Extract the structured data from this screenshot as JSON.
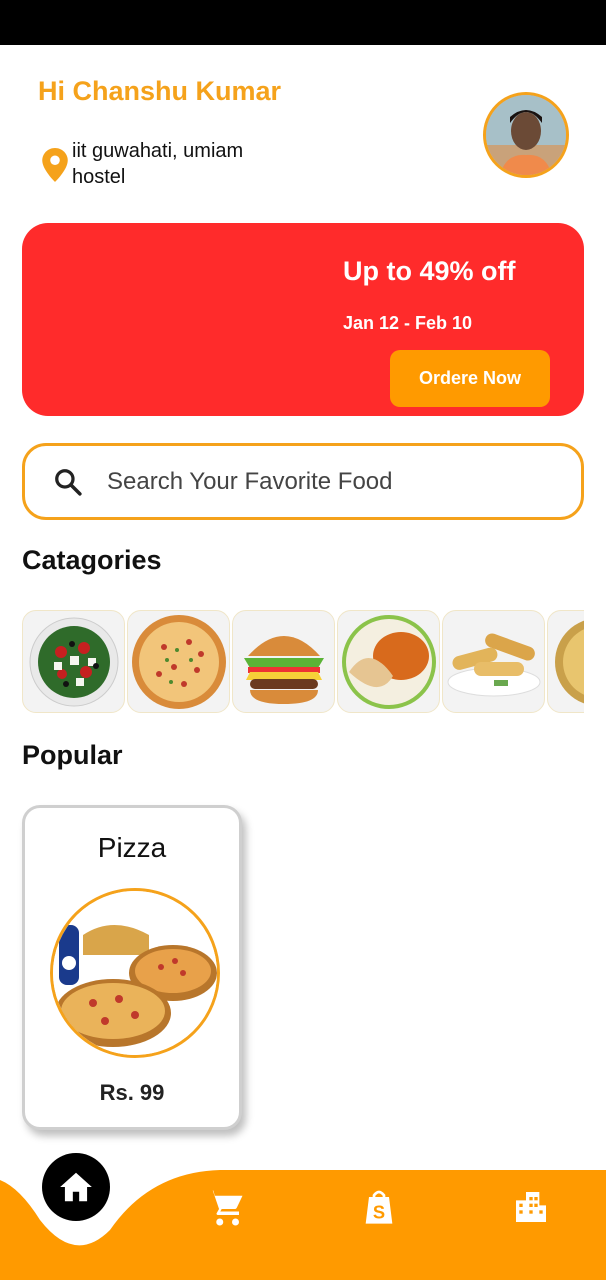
{
  "header": {
    "greeting": "Hi Chanshu Kumar",
    "address": "iit guwahati, umiam hostel"
  },
  "banner": {
    "title": "Up to 49% off",
    "dates": "Jan 12 - Feb 10",
    "button_label": "Ordere Now"
  },
  "search": {
    "placeholder": "Search Your Favorite Food"
  },
  "categories": {
    "title": "Catagories",
    "items": [
      "salad",
      "pizza",
      "burger",
      "curry",
      "spring-rolls",
      "biryani"
    ]
  },
  "popular": {
    "title": "Popular",
    "items": [
      {
        "name": "Pizza",
        "price": "Rs. 99"
      }
    ]
  },
  "nav": {
    "items": [
      "home-icon",
      "cart-icon",
      "shop-icon",
      "building-icon"
    ]
  },
  "colors": {
    "accent": "#f5a21b",
    "banner": "#ff2b2b",
    "button": "#ff9a00",
    "nav": "#ff9a00"
  }
}
